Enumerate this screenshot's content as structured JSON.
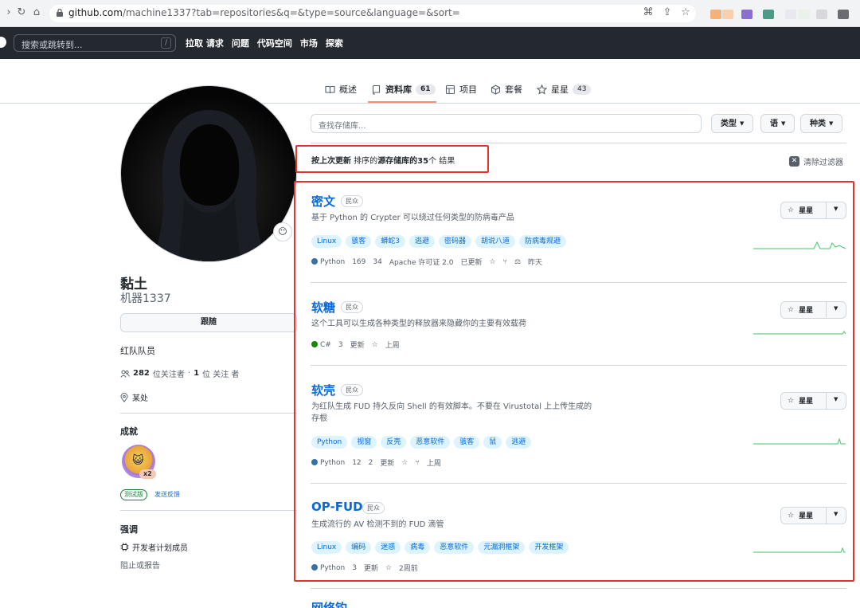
{
  "browser": {
    "url_host": "github.com",
    "url_path": "/machine1337?tab=repositories&q=&type=source&language=&sort="
  },
  "header": {
    "search_placeholder": "搜索或跳转到...",
    "search_shortcut": "/",
    "nav": [
      "拉取 请求",
      "问题",
      "代码空间",
      "市场",
      "探索"
    ]
  },
  "tabs": [
    {
      "label": "概述",
      "icon": "book-icon"
    },
    {
      "label": "资料库",
      "icon": "repo-icon",
      "count": "61"
    },
    {
      "label": "项目",
      "icon": "table-icon"
    },
    {
      "label": "套餐",
      "icon": "package-icon"
    },
    {
      "label": "星星",
      "icon": "star-icon",
      "count": "43"
    }
  ],
  "profile": {
    "status_emoji": "😶",
    "name": "黏土",
    "login": "机器1337",
    "follow_label": "跟随",
    "bio": "红队队员",
    "followers_count": "282",
    "followers_label": "位关注者",
    "following_count": "1",
    "following_label": "位 关注 者",
    "location": "某处",
    "achievements_title": "成就",
    "achievement_multiplier": "x2",
    "beta_label": "测试版",
    "feedback_label": "发送反馈",
    "highlights_title": "强调",
    "highlight_item": "开发者计划成员",
    "report_label": "阻止或报告"
  },
  "filters": {
    "find_placeholder": "查找存储库...",
    "type_label": "类型",
    "language_label": "语",
    "sort_label": "种类",
    "result_prefix": "按上次更新",
    "result_mid": " 排序的",
    "result_bold": "源存储库的35",
    "result_suffix": "个 结果",
    "clear_label": "清除过滤器"
  },
  "star_label": "星星",
  "repos": [
    {
      "name": "密文",
      "visibility": "民众",
      "description": "基于 Python 的 Crypter 可以绕过任何类型的防病毒产品",
      "topics": [
        "Linux",
        "骇客",
        "蟒蛇3",
        "逃避",
        "密码器",
        "胡说八道",
        "防病毒规避"
      ],
      "language": "Python",
      "language_color": "#3572A5",
      "stars": "169",
      "forks": "34",
      "license": "Apache 许可证 2.0",
      "updated_prefix": "已更新",
      "updated": "昨天"
    },
    {
      "name": "软糖",
      "visibility": "民众",
      "description": "这个工具可以生成各种类型的释放器来隐藏你的主要有效载荷",
      "topics": [],
      "language": "C#",
      "language_color": "#178600",
      "stars": "3",
      "updated_prefix": "更新",
      "updated": "上周"
    },
    {
      "name": "软壳",
      "visibility": "民众",
      "description": "为红队生成 FUD 持久反向 Shell 的有效脚本。不要在 Virustotal 上上传生成的存根",
      "topics": [
        "Python",
        "视窗",
        "反壳",
        "恶意软件",
        "骇客",
        "鼠",
        "逃避"
      ],
      "language": "Python",
      "language_color": "#3572A5",
      "stars": "12",
      "forks": "2",
      "updated_prefix": "更新",
      "updated": "上周"
    },
    {
      "name": "OP-FUD",
      "visibility": "民众",
      "description": "生成流行的 AV 检测不到的 FUD 滴管",
      "topics": [
        "Linux",
        "编码",
        "迷惑",
        "病毒",
        "恶意软件",
        "元漏洞框架",
        "开发框架"
      ],
      "language": "Python",
      "language_color": "#3572A5",
      "stars": "3",
      "updated_prefix": "更新",
      "updated": "2周前"
    }
  ],
  "next_repo_peek": "网络钓"
}
